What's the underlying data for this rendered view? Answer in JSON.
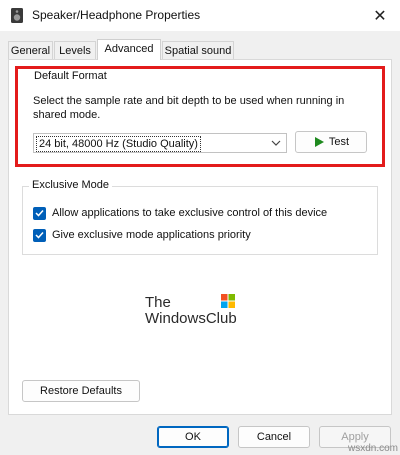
{
  "window": {
    "title": "Speaker/Headphone Properties",
    "close_glyph": "✕"
  },
  "tabs": [
    {
      "label": "General"
    },
    {
      "label": "Levels"
    },
    {
      "label": "Advanced"
    },
    {
      "label": "Spatial sound"
    }
  ],
  "default_format": {
    "label": "Default Format",
    "description": "Select the sample rate and bit depth to be used when running in shared mode.",
    "selected_value": "24 bit, 48000 Hz (Studio Quality)",
    "test_label": "Test"
  },
  "exclusive_mode": {
    "label": "Exclusive Mode",
    "options": [
      {
        "label": "Allow applications to take exclusive control of this device",
        "checked": true
      },
      {
        "label": "Give exclusive mode applications priority",
        "checked": true
      }
    ]
  },
  "logo": {
    "line1": "The",
    "line2": "WindowsClub"
  },
  "restore_defaults_label": "Restore Defaults",
  "footer": {
    "ok_label": "OK",
    "cancel_label": "Cancel",
    "apply_label": "Apply"
  },
  "watermark": "wsxdn.com",
  "colors": {
    "accent": "#005fb8",
    "highlight_outline": "#e31b1b",
    "test_play": "#1f8a1f"
  }
}
